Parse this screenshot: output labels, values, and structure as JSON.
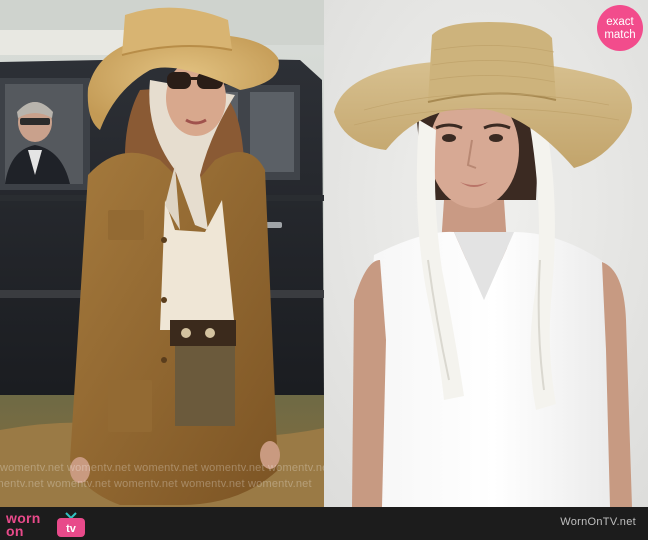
{
  "badge": {
    "line1": "exact",
    "line2": "match"
  },
  "watermark": {
    "text": "womentv.net",
    "rows": [
      "womentv.net  womentv.net  womentv.net  womentv.net  womentv.net",
      "womentv.net  womentv.net  womentv.net  womentv.net  womentv.net"
    ]
  },
  "footer": {
    "logo_line1": "worn",
    "logo_line2": "on",
    "logo_tv": "tv",
    "site_url": "WornOnTV.net"
  },
  "colors": {
    "badge": "#f24c8c",
    "footer_bg": "#1c1c1c",
    "logo_pink": "#e84a8a"
  }
}
